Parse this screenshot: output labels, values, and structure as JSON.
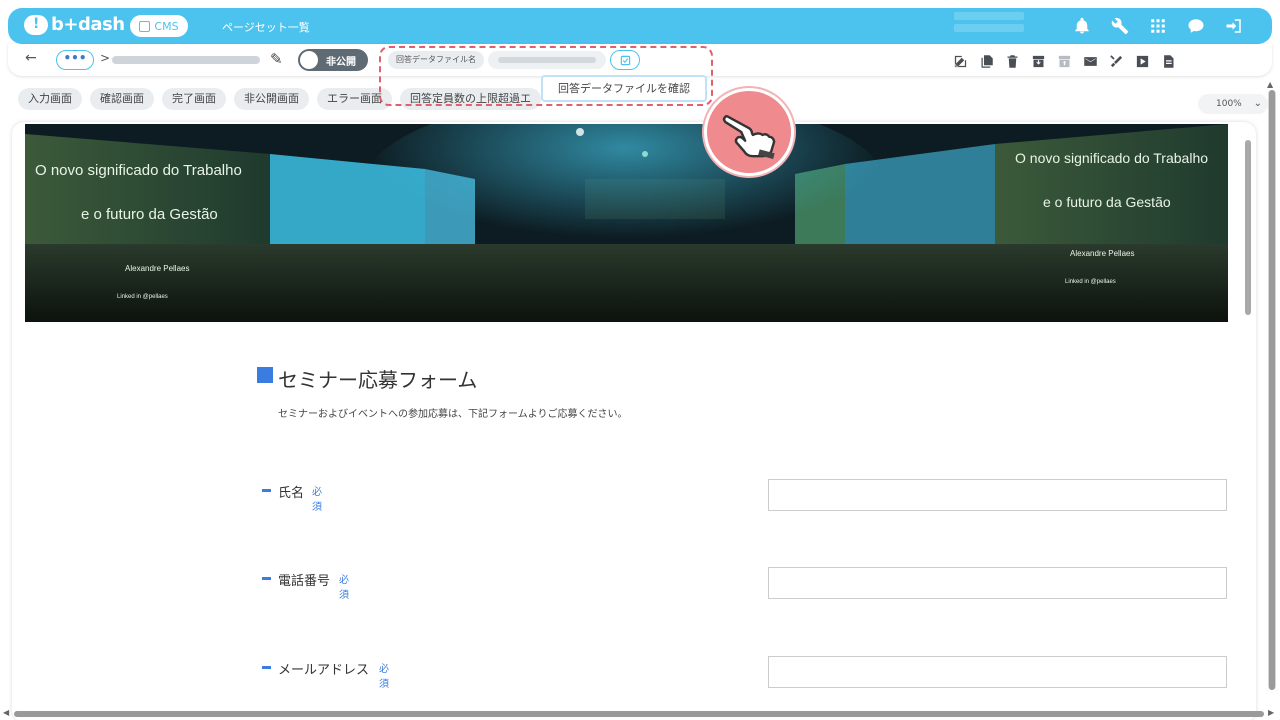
{
  "header": {
    "logo_text": "b+dash",
    "cms_label": "CMS",
    "page_title": "ページセット一覧",
    "icons": [
      "bell-icon",
      "wrench-icon",
      "grid-icon",
      "chat-icon",
      "logout-icon"
    ]
  },
  "toolbar": {
    "back_symbol": "←",
    "more_symbol": "•••",
    "breadcrumb_separator": ">",
    "visibility_toggle_label": "非公開",
    "answer_file_label": "回答データファイル名",
    "check_file_tooltip": "回答データファイルを確認",
    "zoom_value": "100%",
    "action_icons": [
      "edit-icon",
      "copy-icon",
      "trash-icon",
      "archive-icon",
      "unarchive-icon",
      "mail-icon",
      "tools-icon",
      "play-icon",
      "document-icon"
    ]
  },
  "tabs": [
    {
      "label": "入力画面"
    },
    {
      "label": "確認画面"
    },
    {
      "label": "完了画面"
    },
    {
      "label": "非公開画面"
    },
    {
      "label": "エラー画面"
    },
    {
      "label": "回答定員数の上限超過エ"
    }
  ],
  "hero": {
    "left_screen_line1": "O novo significado do Trabalho",
    "left_screen_line2": "e o futuro da Gestão",
    "left_screen_author": "Alexandre Pellaes",
    "left_screen_social": "Linked in   @pellaes",
    "right_screen_line1": "O novo significado do Trabalho",
    "right_screen_line2": "e o futuro da Gestão",
    "right_screen_author": "Alexandre Pellaes",
    "right_screen_social": "Linked in   @pellaes"
  },
  "form": {
    "title": "セミナー応募フォーム",
    "description": "セミナーおよびイベントへの参加応募は、下記フォームよりご応募ください。",
    "fields": [
      {
        "label": "氏名",
        "required": "必須"
      },
      {
        "label": "電話番号",
        "required": "必須"
      },
      {
        "label": "メールアドレス",
        "required": "必須"
      }
    ]
  },
  "colors": {
    "brand": "#4cc3ee",
    "accent": "#3a7ce0",
    "highlight": "#e0606d"
  }
}
